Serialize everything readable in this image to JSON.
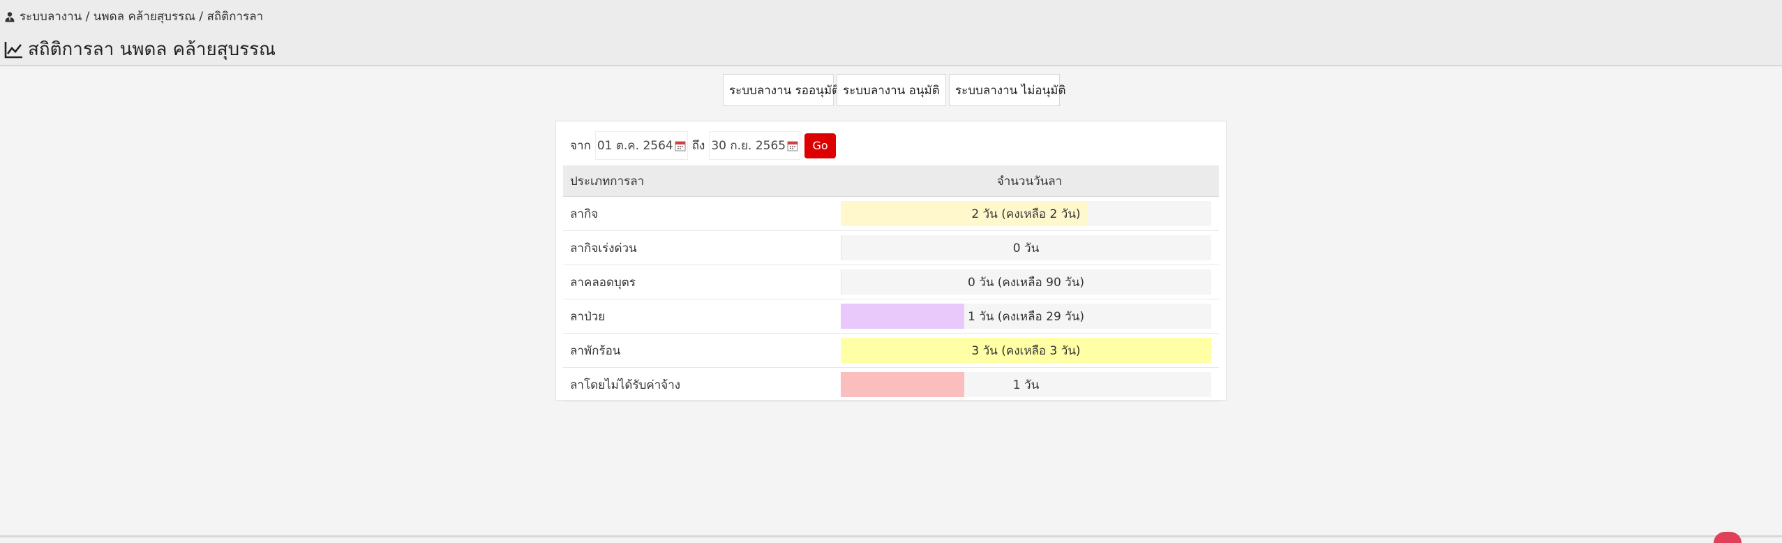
{
  "breadcrumb": {
    "icon": "user-tie-icon",
    "text": "ระบบลางาน / นพดล คล้ายสุบรรณ / สถิติการลา"
  },
  "page_title": {
    "icon": "line-chart-icon",
    "text": "สถิติการลา นพดล คล้ายสุบรรณ"
  },
  "tabs": [
    {
      "label": "ระบบลางาน รออนุมัติ"
    },
    {
      "label": "ระบบลางาน อนุมัติ"
    },
    {
      "label": "ระบบลางาน ไม่อนุมัติ"
    }
  ],
  "filter": {
    "from_label": "จาก",
    "from_value": "01 ต.ค. 2564",
    "to_label": "ถึง",
    "to_value": "30 ก.ย. 2565",
    "go_label": "Go",
    "go_color": "#dc0000"
  },
  "table": {
    "headers": {
      "type": "ประเภทการลา",
      "days": "จำนวนวันลา"
    },
    "rows": [
      {
        "type": "ลากิจ",
        "days_text": "2 วัน (คงเหลือ 2 วัน)",
        "fill": 0.667,
        "color": "#fff8cc"
      },
      {
        "type": "ลากิจเร่งด่วน",
        "days_text": "0 วัน",
        "fill": 0.0,
        "color": "#f0f0f0"
      },
      {
        "type": "ลาคลอดบุตร",
        "days_text": "0 วัน (คงเหลือ 90 วัน)",
        "fill": 0.0,
        "color": "#f0f0f0"
      },
      {
        "type": "ลาป่วย",
        "days_text": "1 วัน (คงเหลือ 29 วัน)",
        "fill": 0.333,
        "color": "#e9c8fb"
      },
      {
        "type": "ลาพักร้อน",
        "days_text": "3 วัน (คงเหลือ 3 วัน)",
        "fill": 1.0,
        "color": "#ffffa6"
      },
      {
        "type": "ลาโดยไม่ได้รับค่าจ้าง",
        "days_text": "1 วัน",
        "fill": 0.333,
        "color": "#fbbebe"
      }
    ]
  }
}
